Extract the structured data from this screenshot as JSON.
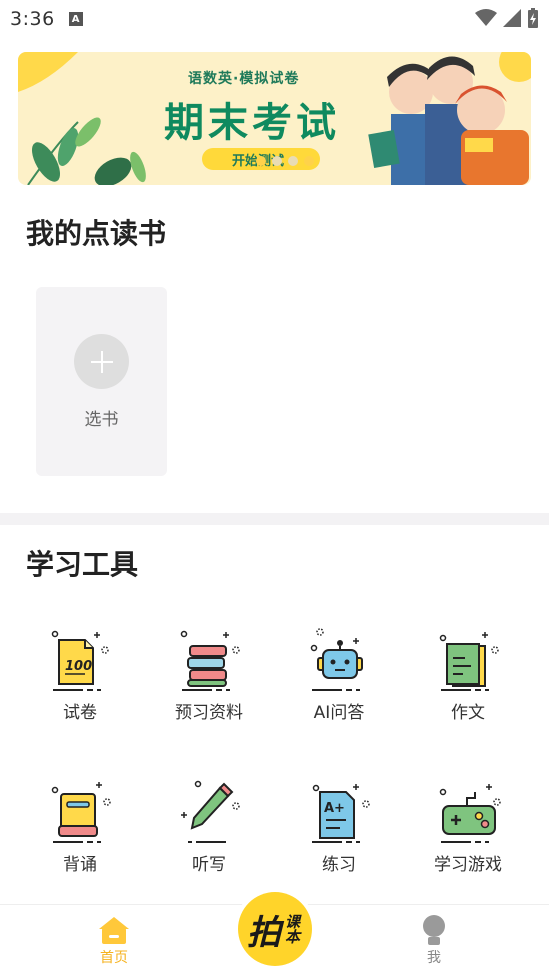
{
  "status_bar": {
    "time": "3:36"
  },
  "banner": {
    "subtitle": "语数英·模拟试卷",
    "title": "期末考试",
    "button": "开始测试",
    "colors": {
      "background": "#fdf1c8",
      "title": "#0f8a5f",
      "accent": "#ffd42a"
    }
  },
  "my_books": {
    "title": "我的点读书",
    "add_card_label": "选书"
  },
  "tools": {
    "title": "学习工具",
    "items": [
      {
        "label": "试卷",
        "icon": "exam-paper-icon"
      },
      {
        "label": "预习资料",
        "icon": "book-stack-icon"
      },
      {
        "label": "AI问答",
        "icon": "robot-icon"
      },
      {
        "label": "作文",
        "icon": "notebook-icon"
      },
      {
        "label": "背诵",
        "icon": "book-icon"
      },
      {
        "label": "听写",
        "icon": "pencil-icon"
      },
      {
        "label": "练习",
        "icon": "graded-paper-icon"
      },
      {
        "label": "学习游戏",
        "icon": "gamepad-icon"
      }
    ]
  },
  "tabbar": {
    "home_label": "首页",
    "center_main": "拍",
    "center_sub": "课本",
    "me_label": "我",
    "active_color": "#f6b320"
  }
}
